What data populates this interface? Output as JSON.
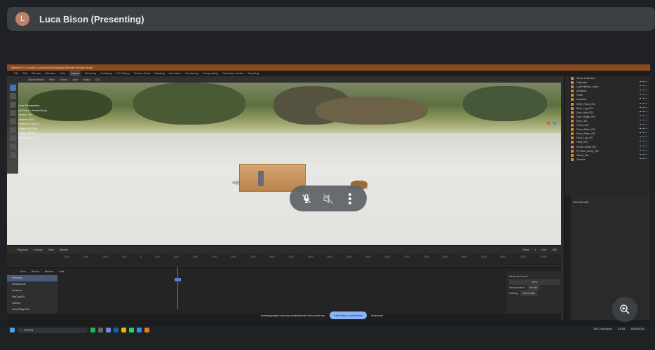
{
  "meet": {
    "avatar_initial": "L",
    "presenter_label": "Luca Bison (Presenting)"
  },
  "blender": {
    "title": "Blender* [C:\\Users\\Luca\\OneDrive\\Desktop\\Blender\\Wheat.blend]",
    "menus": [
      "File",
      "Edit",
      "Render",
      "Window",
      "Help"
    ],
    "workspaces": [
      "Layout",
      "Modeling",
      "Sculpting",
      "UV Editing",
      "Texture Paint",
      "Shading",
      "Animation",
      "Rendering",
      "Compositing",
      "Geometry Nodes",
      "Scripting"
    ],
    "active_workspace": "Layout",
    "header_items": [
      "Object Mode",
      "View",
      "Select",
      "Add",
      "Object",
      "GIS"
    ],
    "stats": [
      "User Perspective",
      "(0) Rsbot | HomeCamp",
      "Scene | (0)",
      "Objects   1/39",
      "Vertices   446,618",
      "Edges   531,185",
      "Faces   288,591",
      "Triangles   612,177"
    ],
    "outliner_rows": [
      "Scene Collection",
      "Collection",
      "LowPolyBarn_Lamb",
      "Armature",
      "Plane",
      "Armature",
      "RBM_Pelvis_001",
      "Back_Leg_001",
      "Dark_Hole_001",
      "Door_Hinge_001",
      "Eyes_001",
      "Fence_001",
      "Front_Stairs_001",
      "Front_Stairs_002",
      "Front_Leg_001",
      "Head_001",
      "Mouth_Detail_001",
      "R_Head_Comp_001",
      "Wheel_001",
      "Camera"
    ],
    "props_header": "HoneyComb",
    "timeline_items": [
      "Playback",
      "Keying",
      "View",
      "Marker"
    ],
    "frame_start_label": "Start",
    "frame_start": "1",
    "frame_end_label": "End",
    "frame_end": "250",
    "ruler_ticks": [
      "-2000",
      "1500",
      "1000",
      "-500",
      "0",
      "500",
      "1000",
      "1500",
      "2000",
      "2500",
      "3000",
      "3500",
      "4000",
      "4500",
      "5000",
      "5500",
      "6000",
      "6500",
      "7000",
      "7500",
      "8000",
      "8500",
      "9000",
      "9500",
      "10000",
      "10500"
    ],
    "graph_items": [
      "View",
      "Select",
      "Marker",
      "Add"
    ],
    "channels": [
      "Summary",
      "HoneyComb",
      "Armature",
      "RatCorp001",
      "Camera",
      "ActionFlags.001"
    ],
    "sidepanel": {
      "header": "Nearest Frame",
      "view_label": "View",
      "interp_label": "Interpolation",
      "interp_value": "Bezier",
      "easing_label": "Easing",
      "easing_value": "Automatic"
    },
    "notification_text": "meetupgoogle.com sta condividendo il tuo schermo.",
    "stop_sharing": "Interrompi condivisione",
    "hide_label": "Nascondi"
  },
  "taskbar": {
    "search_placeholder": "Cerca",
    "weather": "18°C  Nuvoloso",
    "time": "13:18",
    "date": "19/05/2024"
  },
  "controls": {
    "mic_icon": "mic-off-icon",
    "speaker_icon": "speaker-off-icon",
    "more_icon": "more-vert-icon",
    "zoom_icon": "zoom-in-icon"
  }
}
